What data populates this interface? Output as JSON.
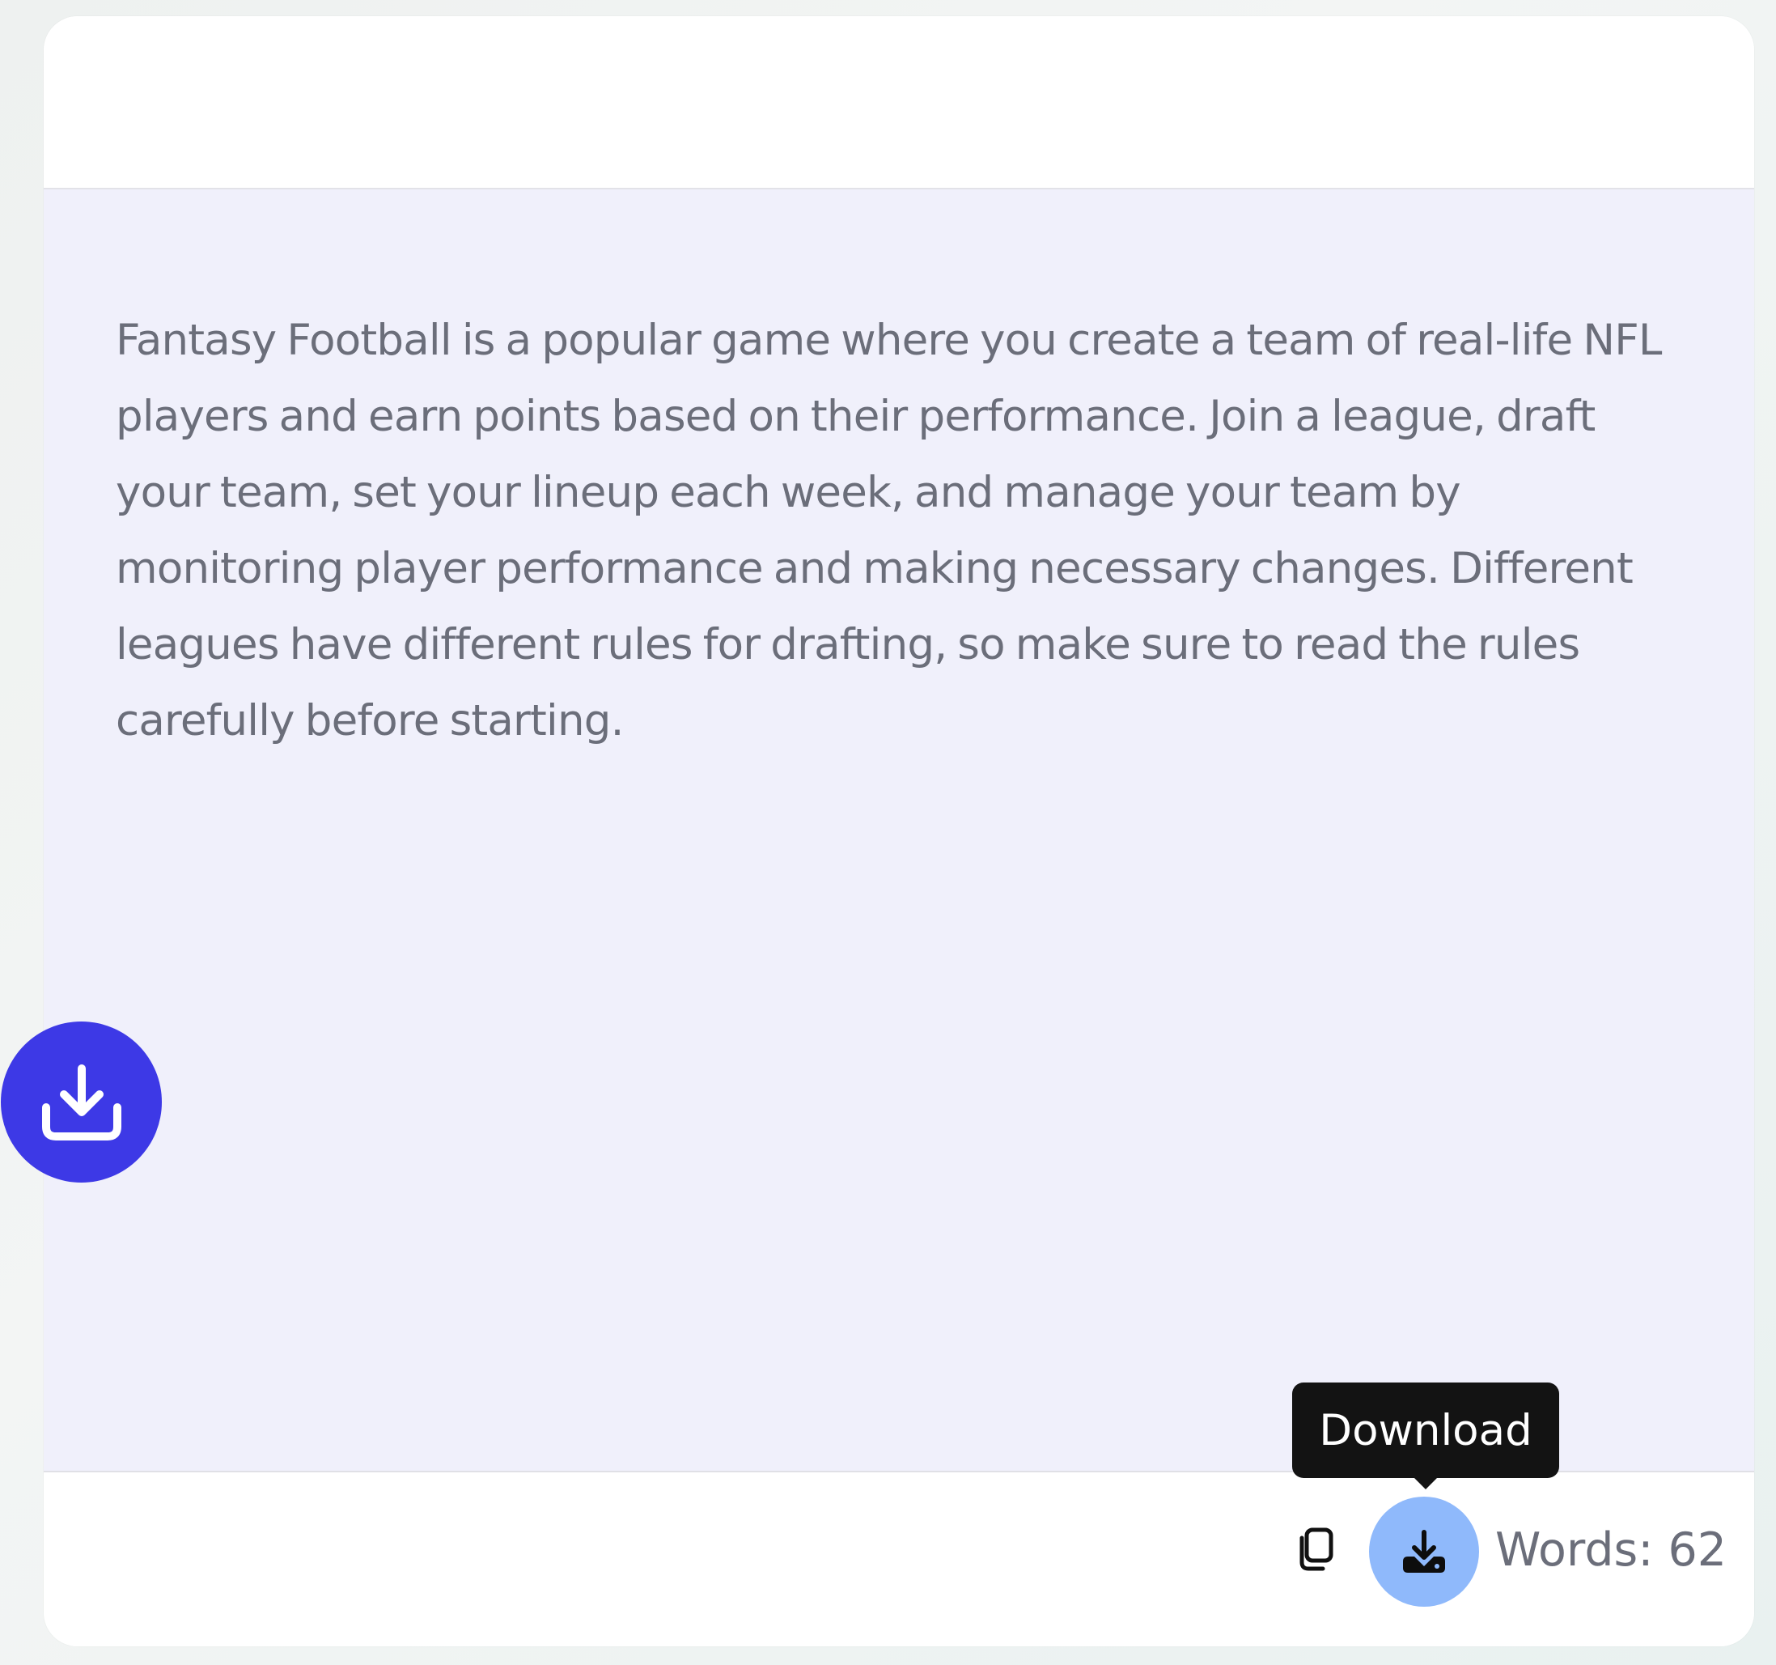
{
  "content": {
    "text": "Fantasy Football is a popular game where you create a team of real-life NFL players and earn points based on their performance. Join a league, draft your team, set your lineup each week, and manage your team by monitoring player performance and making necessary changes. Different leagues have different rules for drafting, so make sure to read the rules carefully before starting."
  },
  "footer": {
    "copy_icon": "copy-icon",
    "download_icon": "download-icon",
    "word_count": "Words: 62"
  },
  "tooltip": {
    "label": "Download"
  },
  "fab": {
    "icon": "download-tray-icon"
  },
  "colors": {
    "content_bg": "#f0f0fb",
    "fab_bg": "#3d39e6",
    "download_btn_bg": "#8fb9fb",
    "tooltip_bg": "#131313",
    "text": "#6b6e7a"
  }
}
